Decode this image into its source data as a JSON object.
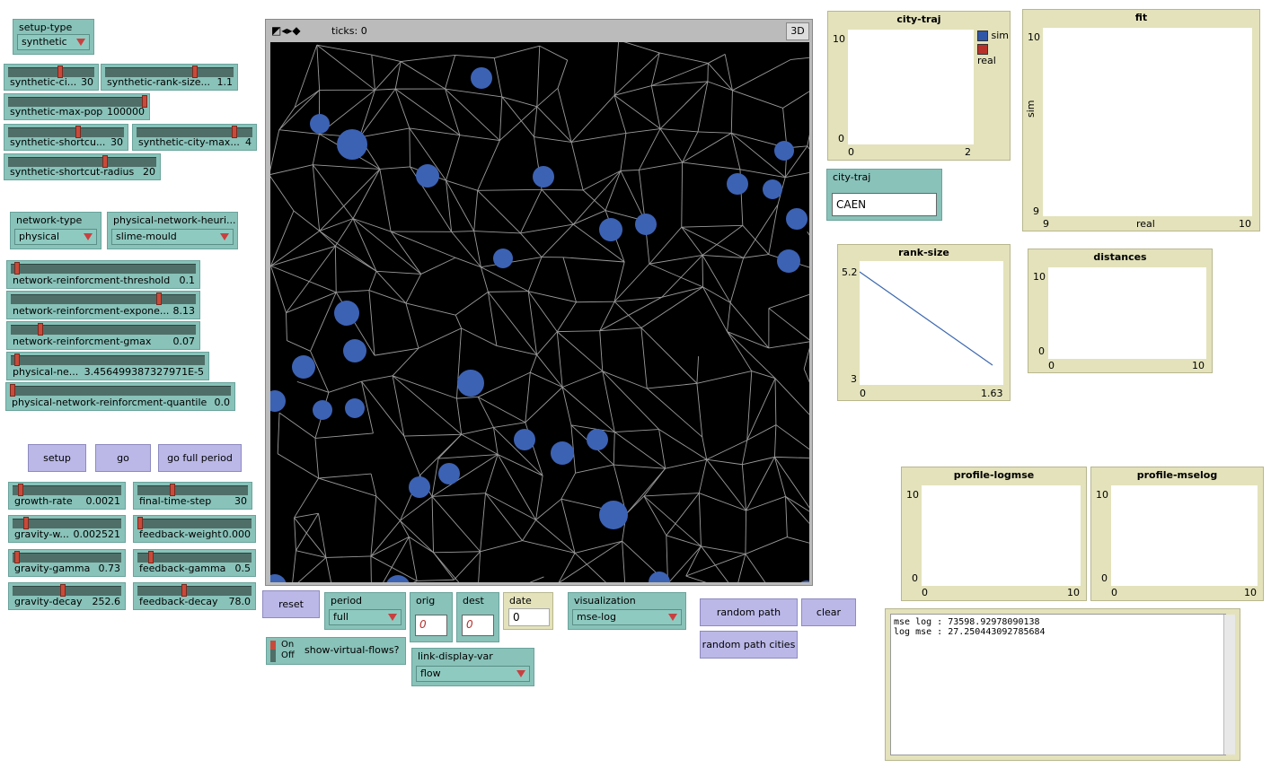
{
  "setup": {
    "setup_type": {
      "label": "setup-type",
      "value": "synthetic"
    },
    "sliders": [
      {
        "label": "synthetic-ci...",
        "value": "30",
        "frac": 0.6
      },
      {
        "label": "synthetic-rank-size...",
        "value": "1.1",
        "frac": 0.7
      },
      {
        "label": "synthetic-max-pop",
        "value": "100000",
        "frac": 1.0
      },
      {
        "label": "synthetic-shortcu...",
        "value": "30",
        "frac": 0.6
      },
      {
        "label": "synthetic-city-max...",
        "value": "4",
        "frac": 0.85
      },
      {
        "label": "synthetic-shortcut-radius",
        "value": "20",
        "frac": 0.65
      }
    ]
  },
  "network": {
    "network_type": {
      "label": "network-type",
      "value": "physical"
    },
    "heuristic": {
      "label": "physical-network-heuri...",
      "value": "slime-mould"
    },
    "sliders": [
      {
        "label": "network-reinforcment-threshold",
        "value": "0.1",
        "frac": 0.02
      },
      {
        "label": "network-reinforcment-expone...",
        "value": "8.13",
        "frac": 0.8
      },
      {
        "label": "network-reinforcment-gmax",
        "value": "0.07",
        "frac": 0.15
      },
      {
        "label": "physical-ne...",
        "value": "3.456499387327971E-5",
        "frac": 0.02
      },
      {
        "label": "physical-network-reinforcment-quantile",
        "value": "0.0",
        "frac": 0.0
      }
    ]
  },
  "buttons": {
    "setup": "setup",
    "go": "go",
    "go_full": "go full period",
    "reset": "reset",
    "random_path": "random path",
    "clear": "clear",
    "random_path_cities": "random path cities"
  },
  "params": [
    {
      "label": "growth-rate",
      "value": "0.0021",
      "frac": 0.05
    },
    {
      "label": "final-time-step",
      "value": "30",
      "frac": 0.3
    },
    {
      "label": "gravity-w...",
      "value": "0.002521",
      "frac": 0.1
    },
    {
      "label": "feedback-weight",
      "value": "0.000",
      "frac": 0.0
    },
    {
      "label": "gravity-gamma",
      "value": "0.73",
      "frac": 0.02
    },
    {
      "label": "feedback-gamma",
      "value": "0.5",
      "frac": 0.1
    },
    {
      "label": "gravity-decay",
      "value": "252.6",
      "frac": 0.45
    },
    {
      "label": "feedback-decay",
      "value": "78.0",
      "frac": 0.4
    }
  ],
  "view": {
    "ticks": "ticks: 0",
    "three_d": "3D"
  },
  "controls": {
    "period": {
      "label": "period",
      "value": "full"
    },
    "orig": {
      "label": "orig",
      "value": "0"
    },
    "dest": {
      "label": "dest",
      "value": "0"
    },
    "date": {
      "label": "date",
      "value": "0"
    },
    "visualization": {
      "label": "visualization",
      "value": "mse-log"
    },
    "show_virtual": {
      "on": "On",
      "off": "Off",
      "label": "show-virtual-flows?"
    },
    "link_display": {
      "label": "link-display-var",
      "value": "flow"
    }
  },
  "city_traj": {
    "label": "city-traj",
    "value": "CAEN"
  },
  "plots": {
    "city_traj": {
      "title": "city-traj",
      "ymax": "10",
      "ymin": "0",
      "xmin": "0",
      "xmax": "2",
      "legend": [
        {
          "name": "sim",
          "color": "#2f57a8"
        },
        {
          "name": "real",
          "color": "#b8322b"
        }
      ]
    },
    "fit": {
      "title": "fit",
      "ymax": "10",
      "ymin": "9",
      "xmin": "9",
      "xmax": "10",
      "xlabel": "real",
      "ylabel": "sim"
    },
    "rank_size": {
      "title": "rank-size",
      "ymax": "5.2",
      "ymin": "3",
      "xmin": "0",
      "xmax": "1.63"
    },
    "distances": {
      "title": "distances",
      "ymax": "10",
      "ymin": "0",
      "xmin": "0",
      "xmax": "10"
    },
    "profile_logmse": {
      "title": "profile-logmse",
      "ymax": "10",
      "ymin": "0",
      "xmin": "0",
      "xmax": "10"
    },
    "profile_mselog": {
      "title": "profile-mselog",
      "ymax": "10",
      "ymin": "0",
      "xmin": "0",
      "xmax": "10"
    }
  },
  "chart_data": {
    "type": "line",
    "title": "rank-size",
    "x": [
      0,
      1.63
    ],
    "series": [
      {
        "values": [
          5.2,
          3.0
        ],
        "color": "#3c68b0"
      }
    ],
    "xlim": [
      0,
      1.63
    ],
    "ylim": [
      3,
      5.2
    ]
  },
  "output": {
    "line1": "mse log : 73598.92978090138",
    "line2": "log mse : 27.250443092785684"
  }
}
